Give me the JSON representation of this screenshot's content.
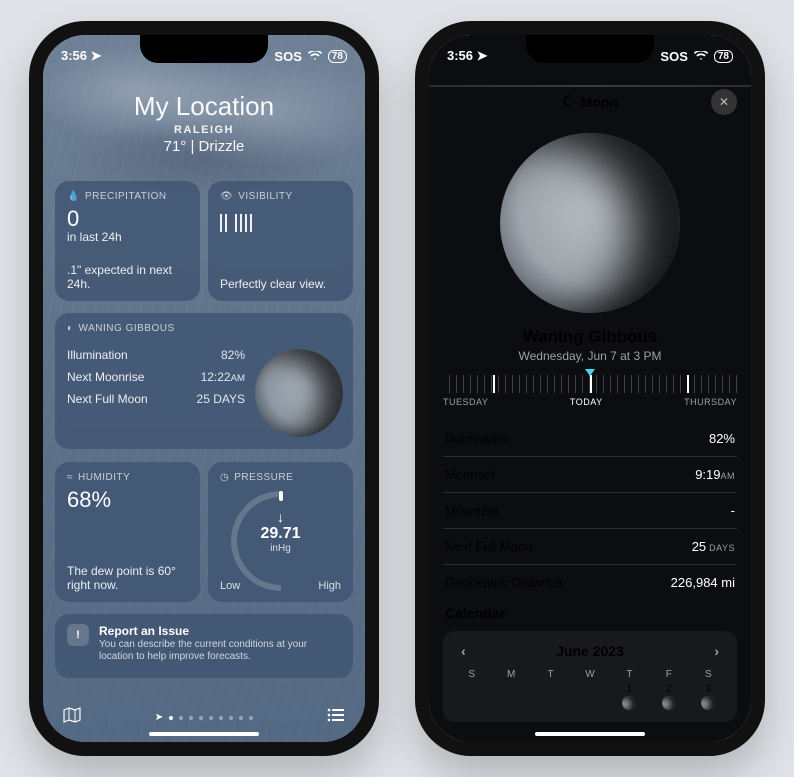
{
  "status": {
    "time": "3:56",
    "carrier": "SOS",
    "battery": "78"
  },
  "weather": {
    "title": "My Location",
    "city": "RALEIGH",
    "temp": "71°",
    "sep": "  |  ",
    "cond": "Drizzle",
    "precip": {
      "hdr": "PRECIPITATION",
      "value": "0",
      "unit": "in last 24h",
      "foot": ".1\" expected in next 24h."
    },
    "visibility": {
      "hdr": "VISIBILITY",
      "foot": "Perfectly clear view."
    },
    "moon": {
      "hdr": "WANING GIBBOUS",
      "rows": [
        {
          "k": "Illumination",
          "v": "82%"
        },
        {
          "k": "Next Moonrise",
          "v": "12:22",
          "unit": "AM"
        },
        {
          "k": "Next Full Moon",
          "v": "25 DAYS"
        }
      ]
    },
    "humidity": {
      "hdr": "HUMIDITY",
      "value": "68%",
      "foot": "The dew point is 60° right now."
    },
    "pressure": {
      "hdr": "PRESSURE",
      "value": "29.71",
      "unit": "inHg",
      "low": "Low",
      "high": "High"
    },
    "issue": {
      "title": "Report an Issue",
      "desc": "You can describe the current conditions at your location to help improve forecasts."
    }
  },
  "moonDetail": {
    "title": "Moon",
    "phase": "Waning Gibbous",
    "date": "Wednesday, Jun 7 at 3 PM",
    "scrubber": {
      "prev": "TUESDAY",
      "today": "TODAY",
      "next": "THURSDAY"
    },
    "stats": [
      {
        "k": "Illumination",
        "v": "82%"
      },
      {
        "k": "Moonset",
        "v": "9:19",
        "unit": "AM"
      },
      {
        "k": "Moonrise",
        "v": "-"
      },
      {
        "k": "Next Full Moon",
        "v": "25",
        "unit": " DAYS"
      },
      {
        "k": "Geocentric Distance",
        "v": "226,984 mi"
      }
    ],
    "calendar": {
      "label": "Calendar",
      "month": "June 2023",
      "days": [
        "S",
        "M",
        "T",
        "W",
        "T",
        "F",
        "S"
      ],
      "cells": [
        "",
        "",
        "",
        "",
        "1",
        "2",
        "3"
      ]
    }
  }
}
